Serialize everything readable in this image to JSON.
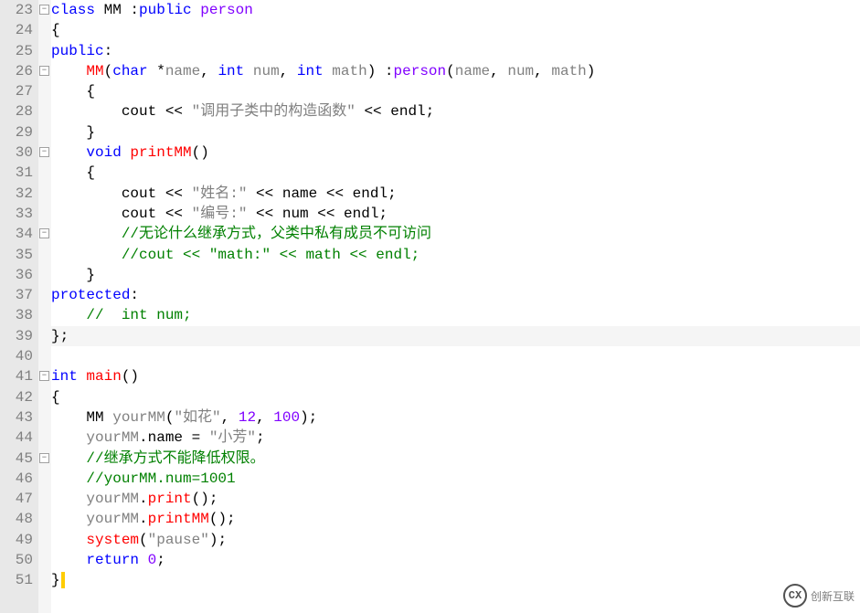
{
  "lines": [
    {
      "n": "23",
      "fold": "-",
      "seg": [
        [
          "kw-blue",
          "class"
        ],
        [
          "ident",
          " MM "
        ],
        [
          "ident",
          ":"
        ],
        [
          "kw-blue",
          "public"
        ],
        [
          "ident",
          " "
        ],
        [
          "kw-purple",
          "person"
        ]
      ]
    },
    {
      "n": "24",
      "fold": "",
      "seg": [
        [
          "ident",
          "{"
        ]
      ]
    },
    {
      "n": "25",
      "fold": "",
      "seg": [
        [
          "kw-blue",
          "public"
        ],
        [
          "ident",
          ":"
        ]
      ]
    },
    {
      "n": "26",
      "fold": "-",
      "seg": [
        [
          "ident",
          "    "
        ],
        [
          "fn-red",
          "MM"
        ],
        [
          "ident",
          "("
        ],
        [
          "kw-blue",
          "char"
        ],
        [
          "ident",
          " *"
        ],
        [
          "gray",
          "name"
        ],
        [
          "ident",
          ", "
        ],
        [
          "kw-blue",
          "int"
        ],
        [
          "ident",
          " "
        ],
        [
          "gray",
          "num"
        ],
        [
          "ident",
          ", "
        ],
        [
          "kw-blue",
          "int"
        ],
        [
          "ident",
          " "
        ],
        [
          "gray",
          "math"
        ],
        [
          "ident",
          ") :"
        ],
        [
          "kw-purple",
          "person"
        ],
        [
          "ident",
          "("
        ],
        [
          "gray",
          "name"
        ],
        [
          "ident",
          ", "
        ],
        [
          "gray",
          "num"
        ],
        [
          "ident",
          ", "
        ],
        [
          "gray",
          "math"
        ],
        [
          "ident",
          ")"
        ]
      ]
    },
    {
      "n": "27",
      "fold": "",
      "seg": [
        [
          "ident",
          "    {"
        ]
      ]
    },
    {
      "n": "28",
      "fold": "",
      "seg": [
        [
          "ident",
          "        cout << "
        ],
        [
          "str",
          "\"调用子类中的构造函数\""
        ],
        [
          "ident",
          " << endl;"
        ]
      ]
    },
    {
      "n": "29",
      "fold": "",
      "seg": [
        [
          "ident",
          "    }"
        ]
      ]
    },
    {
      "n": "30",
      "fold": "-",
      "seg": [
        [
          "ident",
          "    "
        ],
        [
          "kw-blue",
          "void"
        ],
        [
          "ident",
          " "
        ],
        [
          "fn-red",
          "printMM"
        ],
        [
          "ident",
          "()"
        ]
      ]
    },
    {
      "n": "31",
      "fold": "",
      "seg": [
        [
          "ident",
          "    {"
        ]
      ]
    },
    {
      "n": "32",
      "fold": "",
      "seg": [
        [
          "ident",
          "        cout << "
        ],
        [
          "str",
          "\"姓名:\""
        ],
        [
          "ident",
          " << name << endl;"
        ]
      ]
    },
    {
      "n": "33",
      "fold": "",
      "seg": [
        [
          "ident",
          "        cout << "
        ],
        [
          "str",
          "\"编号:\""
        ],
        [
          "ident",
          " << num << endl;"
        ]
      ]
    },
    {
      "n": "34",
      "fold": "-",
      "seg": [
        [
          "ident",
          "        "
        ],
        [
          "comment",
          "//无论什么继承方式，父类中私有成员不可访问"
        ]
      ]
    },
    {
      "n": "35",
      "fold": "",
      "seg": [
        [
          "ident",
          "        "
        ],
        [
          "comment",
          "//cout << \"math:\" << math << endl;"
        ]
      ]
    },
    {
      "n": "36",
      "fold": "",
      "seg": [
        [
          "ident",
          "    }"
        ]
      ]
    },
    {
      "n": "37",
      "fold": "",
      "seg": [
        [
          "kw-blue",
          "protected"
        ],
        [
          "ident",
          ":"
        ]
      ]
    },
    {
      "n": "38",
      "fold": "",
      "seg": [
        [
          "ident",
          "    "
        ],
        [
          "comment",
          "//  int num;"
        ]
      ]
    },
    {
      "n": "39",
      "fold": "",
      "hl": true,
      "seg": [
        [
          "ident",
          "};"
        ]
      ]
    },
    {
      "n": "40",
      "fold": "",
      "seg": [
        [
          "ident",
          ""
        ]
      ]
    },
    {
      "n": "41",
      "fold": "-",
      "seg": [
        [
          "kw-blue",
          "int"
        ],
        [
          "ident",
          " "
        ],
        [
          "fn-red",
          "main"
        ],
        [
          "ident",
          "()"
        ]
      ]
    },
    {
      "n": "42",
      "fold": "",
      "seg": [
        [
          "ident",
          "{"
        ]
      ]
    },
    {
      "n": "43",
      "fold": "",
      "seg": [
        [
          "ident",
          "    MM "
        ],
        [
          "gray",
          "yourMM"
        ],
        [
          "ident",
          "("
        ],
        [
          "str",
          "\"如花\""
        ],
        [
          "ident",
          ", "
        ],
        [
          "kw-purple",
          "12"
        ],
        [
          "ident",
          ", "
        ],
        [
          "kw-purple",
          "100"
        ],
        [
          "ident",
          ");"
        ]
      ]
    },
    {
      "n": "44",
      "fold": "",
      "seg": [
        [
          "ident",
          "    "
        ],
        [
          "gray",
          "yourMM"
        ],
        [
          "ident",
          ".name = "
        ],
        [
          "str",
          "\"小芳\""
        ],
        [
          "ident",
          ";"
        ]
      ]
    },
    {
      "n": "45",
      "fold": "-",
      "seg": [
        [
          "ident",
          "    "
        ],
        [
          "comment",
          "//继承方式不能降低权限。"
        ]
      ]
    },
    {
      "n": "46",
      "fold": "",
      "seg": [
        [
          "ident",
          "    "
        ],
        [
          "comment",
          "//yourMM.num=1001"
        ]
      ]
    },
    {
      "n": "47",
      "fold": "",
      "seg": [
        [
          "ident",
          "    "
        ],
        [
          "gray",
          "yourMM"
        ],
        [
          "ident",
          "."
        ],
        [
          "fn-red",
          "print"
        ],
        [
          "ident",
          "();"
        ]
      ]
    },
    {
      "n": "48",
      "fold": "",
      "seg": [
        [
          "ident",
          "    "
        ],
        [
          "gray",
          "yourMM"
        ],
        [
          "ident",
          "."
        ],
        [
          "fn-red",
          "printMM"
        ],
        [
          "ident",
          "();"
        ]
      ]
    },
    {
      "n": "49",
      "fold": "",
      "seg": [
        [
          "ident",
          "    "
        ],
        [
          "fn-red",
          "system"
        ],
        [
          "ident",
          "("
        ],
        [
          "str",
          "\"pause\""
        ],
        [
          "ident",
          ");"
        ]
      ]
    },
    {
      "n": "50",
      "fold": "",
      "seg": [
        [
          "ident",
          "    "
        ],
        [
          "kw-blue",
          "return"
        ],
        [
          "ident",
          " "
        ],
        [
          "kw-purple",
          "0"
        ],
        [
          "ident",
          ";"
        ]
      ]
    },
    {
      "n": "51",
      "fold": "",
      "cursor": true,
      "seg": [
        [
          "ident",
          "}"
        ]
      ]
    }
  ],
  "watermark": {
    "logo": "CX",
    "text": "创新互联"
  }
}
